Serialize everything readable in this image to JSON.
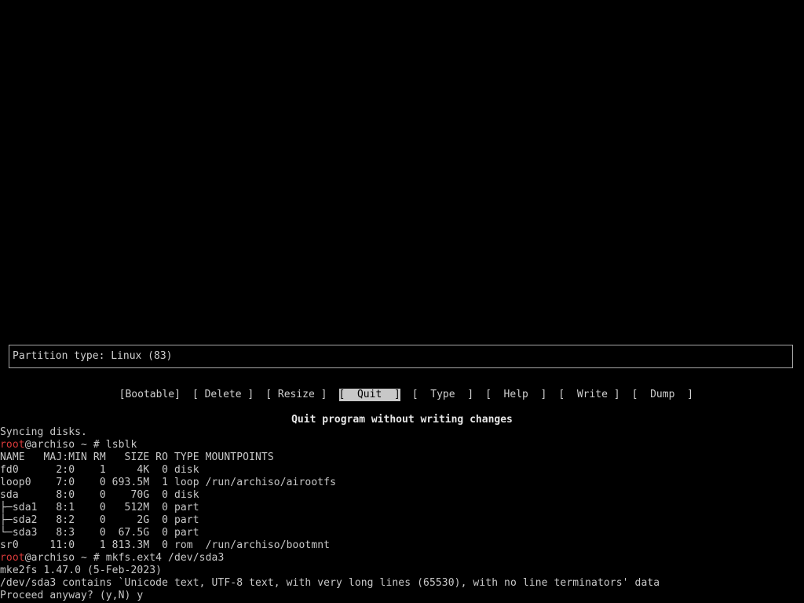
{
  "cfdisk": {
    "partition_info": "Partition type: Linux (83)",
    "menu": [
      {
        "label": "[Bootable]",
        "selected": false
      },
      {
        "label": "[ Delete ]",
        "selected": false
      },
      {
        "label": "[ Resize ]",
        "selected": false
      },
      {
        "label": "[  Quit  ]",
        "selected": true
      },
      {
        "label": "[  Type  ]",
        "selected": false
      },
      {
        "label": "[  Help  ]",
        "selected": false
      },
      {
        "label": "[  Write ]",
        "selected": false
      },
      {
        "label": "[  Dump  ]",
        "selected": false
      }
    ],
    "hint": "Quit program without writing changes"
  },
  "terminal": {
    "syncing": "Syncing disks.",
    "prompt1": {
      "user": "root",
      "host_path": "@archiso ~ # ",
      "command": "lsblk"
    },
    "lsblk": {
      "header": "NAME   MAJ:MIN RM   SIZE RO TYPE MOUNTPOINTS",
      "rows": [
        "fd0      2:0    1     4K  0 disk",
        "loop0    7:0    0 693.5M  1 loop /run/archiso/airootfs",
        "sda      8:0    0    70G  0 disk",
        "├─sda1   8:1    0   512M  0 part",
        "├─sda2   8:2    0     2G  0 part",
        "└─sda3   8:3    0  67.5G  0 part",
        "sr0     11:0    1 813.3M  0 rom  /run/archiso/bootmnt"
      ]
    },
    "prompt2": {
      "user": "root",
      "host_path": "@archiso ~ # ",
      "command": "mkfs.ext4 /dev/sda3"
    },
    "mkfs_version": "mke2fs 1.47.0 (5-Feb-2023)",
    "mkfs_warning": "/dev/sda3 contains `Unicode text, UTF-8 text, with very long lines (65530), with no line terminators' data",
    "proceed": "Proceed anyway? (y,N) y"
  },
  "colors": {
    "background": "#000000",
    "text": "#c8c8c8",
    "prompt_user": "#d93a3a",
    "selected_bg": "#c8c8c8"
  }
}
